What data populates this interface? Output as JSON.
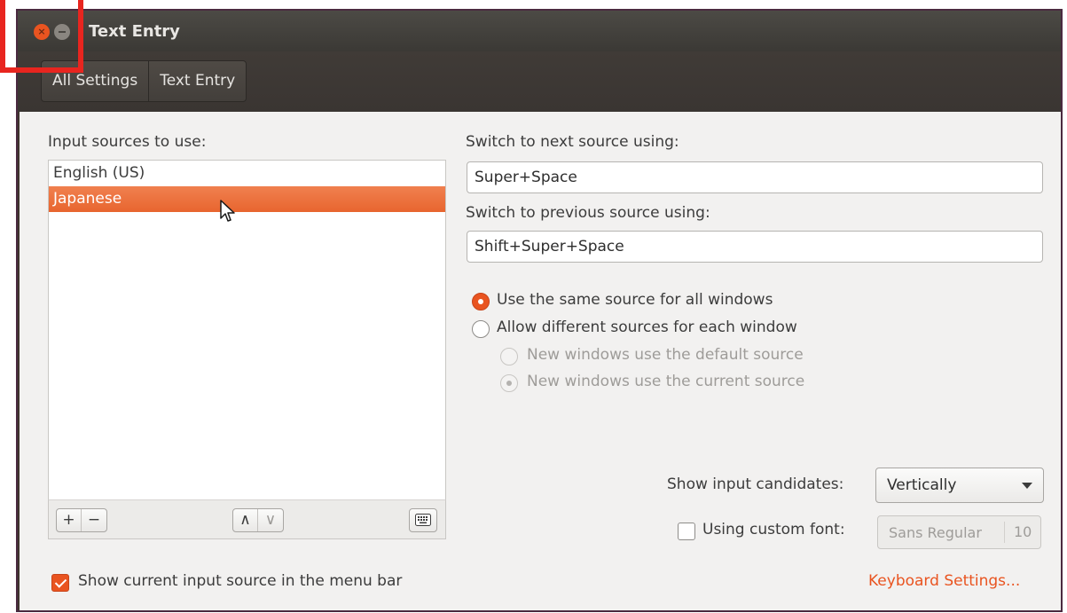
{
  "window": {
    "title": "Text Entry",
    "close_glyph": "×"
  },
  "breadcrumbs": [
    "All Settings",
    "Text Entry"
  ],
  "input_sources": {
    "label": "Input sources to use:",
    "items": [
      "English (US)",
      "Japanese"
    ],
    "selected_index": 1,
    "toolbar": {
      "add": "+",
      "remove": "−",
      "up": "∧",
      "down": "∨",
      "keyboard_icon": "keyboard-icon"
    }
  },
  "show_current_source": {
    "label": "Show current input source in the menu bar",
    "checked": true
  },
  "switch_next": {
    "label": "Switch to next source using:",
    "value": "Super+Space"
  },
  "switch_previous": {
    "label": "Switch to previous source using:",
    "value": "Shift+Super+Space"
  },
  "source_mode": {
    "same_for_all": "Use the same source for all windows",
    "different_each": "Allow different sources for each window",
    "new_default": "New windows use the default source",
    "new_current": "New windows use the current source"
  },
  "candidates": {
    "label": "Show input candidates:",
    "value": "Vertically"
  },
  "custom_font": {
    "label": "Using custom font:",
    "checked": false,
    "font_name": "Sans Regular",
    "font_size": "10"
  },
  "keyboard_settings_link": "Keyboard Settings...",
  "colors": {
    "accent": "#e95420",
    "annotation_box": "#e8251f"
  }
}
